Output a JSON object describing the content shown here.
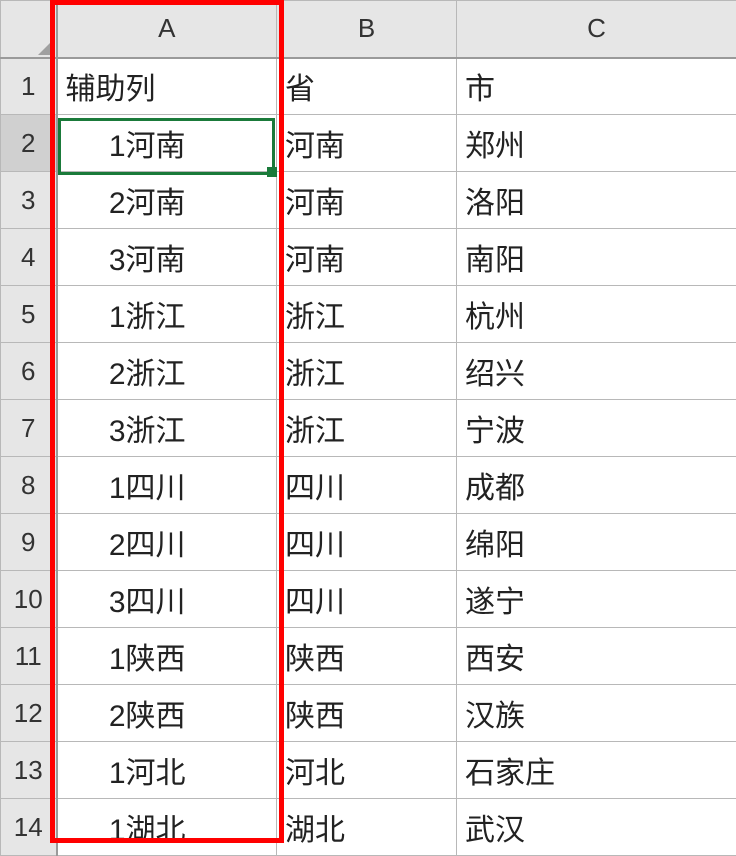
{
  "columns": [
    "A",
    "B",
    "C"
  ],
  "header_row": {
    "a": "辅助列",
    "b": "省",
    "c": "市"
  },
  "rows": [
    {
      "n": "1",
      "a": "辅助列",
      "b": "省",
      "c": "市",
      "prefix": ""
    },
    {
      "n": "2",
      "a": "1河南",
      "b": "河南",
      "c": "郑州",
      "prefix": "1"
    },
    {
      "n": "3",
      "a": "2河南",
      "b": "河南",
      "c": "洛阳",
      "prefix": "2"
    },
    {
      "n": "4",
      "a": "3河南",
      "b": "河南",
      "c": "南阳",
      "prefix": "3"
    },
    {
      "n": "5",
      "a": "1浙江",
      "b": "浙江",
      "c": "杭州",
      "prefix": "1"
    },
    {
      "n": "6",
      "a": "2浙江",
      "b": "浙江",
      "c": "绍兴",
      "prefix": "2"
    },
    {
      "n": "7",
      "a": "3浙江",
      "b": "浙江",
      "c": "宁波",
      "prefix": "3"
    },
    {
      "n": "8",
      "a": "1四川",
      "b": "四川",
      "c": "成都",
      "prefix": "1"
    },
    {
      "n": "9",
      "a": "2四川",
      "b": "四川",
      "c": "绵阳",
      "prefix": "2"
    },
    {
      "n": "10",
      "a": "3四川",
      "b": "四川",
      "c": "遂宁",
      "prefix": "3"
    },
    {
      "n": "11",
      "a": "1陕西",
      "b": "陕西",
      "c": "西安",
      "prefix": "1"
    },
    {
      "n": "12",
      "a": "2陕西",
      "b": "陕西",
      "c": "汉族",
      "prefix": "2"
    },
    {
      "n": "13",
      "a": "1河北",
      "b": "河北",
      "c": "石家庄",
      "prefix": "1"
    },
    {
      "n": "14",
      "a": "1湖北",
      "b": "湖北",
      "c": "武汉",
      "prefix": "1"
    }
  ],
  "active_row": "2",
  "colors": {
    "highlight_border": "#ff0000",
    "selection_border": "#1a7a3a",
    "header_bg": "#e6e6e6",
    "grid_line": "#b8b8b8"
  }
}
